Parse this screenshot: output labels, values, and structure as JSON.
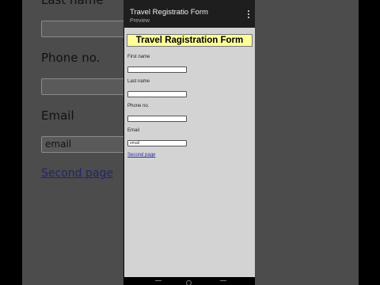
{
  "background": {
    "last_name_label": "Last name",
    "phone_label": "Phone no.",
    "email_label": "Email",
    "email_value": "email",
    "second_page_link": "Second page"
  },
  "status_bar": {
    "time": "",
    "icons": ""
  },
  "app_bar": {
    "title": "Travel Registratio Form",
    "subtitle": "Preview"
  },
  "form": {
    "heading": "Travel Ragistration Form",
    "heading_color": "#ffff99",
    "fields": [
      {
        "label": "First name",
        "value": ""
      },
      {
        "label": "Last name",
        "value": ""
      },
      {
        "label": "Phone no.",
        "value": ""
      },
      {
        "label": "Email",
        "value": "email"
      }
    ],
    "link": "Second page"
  }
}
